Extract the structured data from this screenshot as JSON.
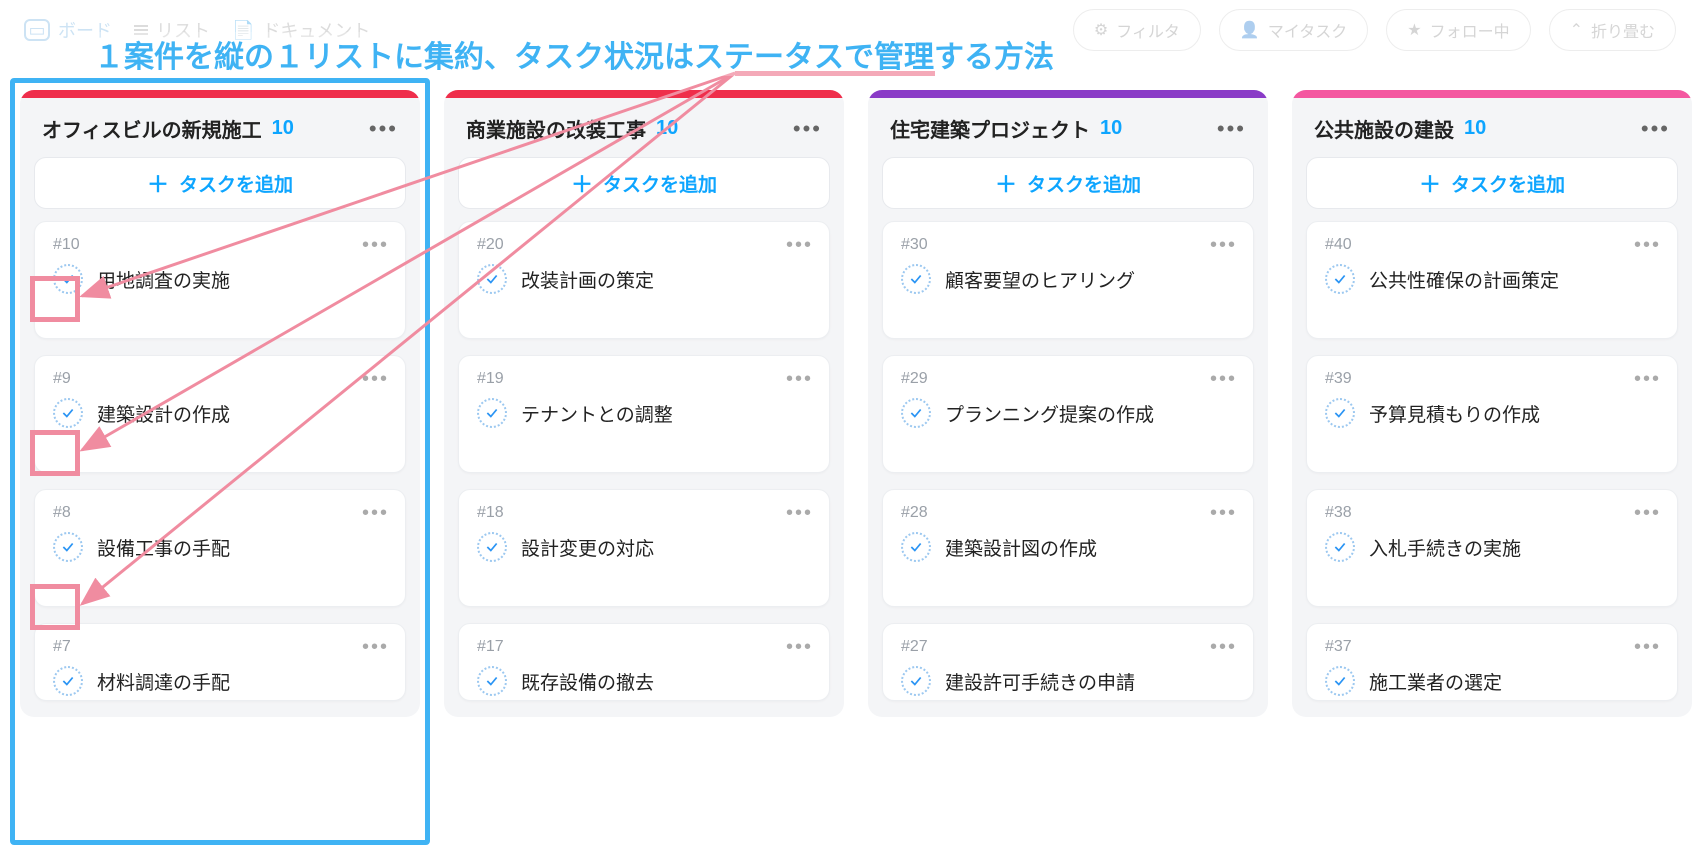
{
  "annotation_title": "１案件を縦の１リストに集約、タスク状況はステータスで管理する方法",
  "toolbar": {
    "tab_board": "ボード",
    "tab_list": "リスト",
    "tab_doc": "ドキュメント",
    "filter": "フィルタ",
    "mytask": "マイタスク",
    "follow": "フォロー中",
    "collapse": "折り畳む"
  },
  "add_task_label": "タスクを追加",
  "lists": [
    {
      "title": "オフィスビルの新規施工",
      "count": "10",
      "strip_color": "#ef2e4b",
      "cards": [
        {
          "id": "#10",
          "title": "用地調査の実施"
        },
        {
          "id": "#9",
          "title": "建築設計の作成"
        },
        {
          "id": "#8",
          "title": "設備工事の手配"
        },
        {
          "id": "#7",
          "title": "材料調達の手配"
        }
      ]
    },
    {
      "title": "商業施設の改装工事",
      "count": "10",
      "strip_color": "#ef2e4b",
      "cards": [
        {
          "id": "#20",
          "title": "改装計画の策定"
        },
        {
          "id": "#19",
          "title": "テナントとの調整"
        },
        {
          "id": "#18",
          "title": "設計変更の対応"
        },
        {
          "id": "#17",
          "title": "既存設備の撤去"
        }
      ]
    },
    {
      "title": "住宅建築プロジェクト",
      "count": "10",
      "strip_color": "#8a3bc7",
      "cards": [
        {
          "id": "#30",
          "title": "顧客要望のヒアリング"
        },
        {
          "id": "#29",
          "title": "プランニング提案の作成"
        },
        {
          "id": "#28",
          "title": "建築設計図の作成"
        },
        {
          "id": "#27",
          "title": "建設許可手続きの申請"
        }
      ]
    },
    {
      "title": "公共施設の建設",
      "count": "10",
      "strip_color": "#f457a0",
      "cards": [
        {
          "id": "#40",
          "title": "公共性確保の計画策定"
        },
        {
          "id": "#39",
          "title": "予算見積もりの作成"
        },
        {
          "id": "#38",
          "title": "入札手続きの実施"
        },
        {
          "id": "#37",
          "title": "施工業者の選定"
        }
      ]
    }
  ]
}
